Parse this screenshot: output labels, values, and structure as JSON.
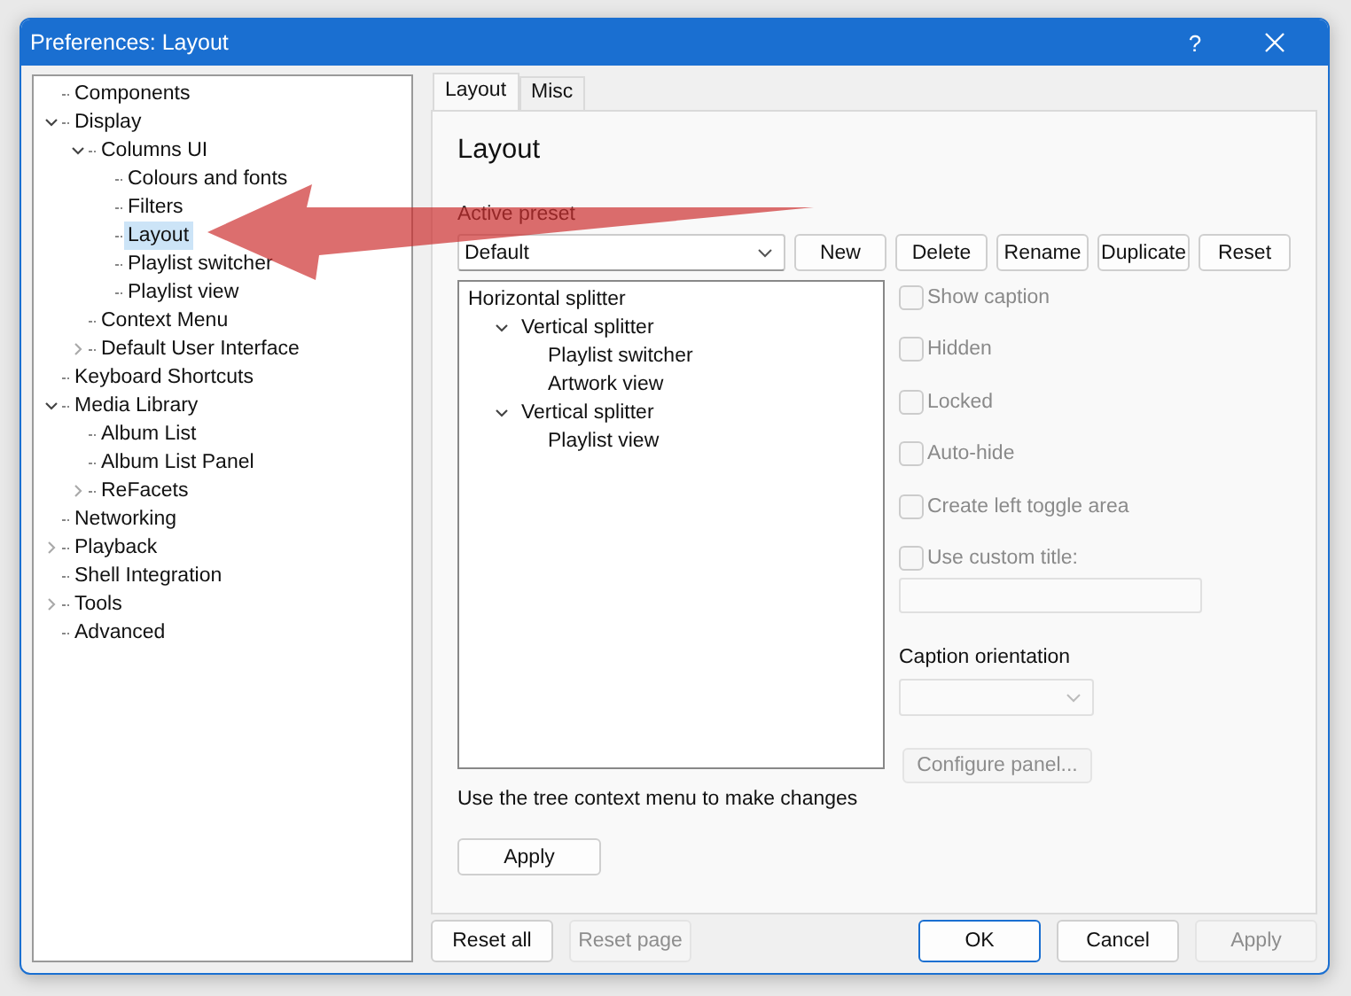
{
  "window": {
    "title": "Preferences: Layout",
    "help": "?"
  },
  "tree": [
    {
      "label": "Components",
      "selected": false
    },
    {
      "label": "Display",
      "selected": false,
      "expanded": true,
      "children": [
        {
          "label": "Columns UI",
          "selected": false,
          "expanded": true,
          "children": [
            {
              "label": "Colours and fonts",
              "selected": false
            },
            {
              "label": "Filters",
              "selected": false
            },
            {
              "label": "Layout",
              "selected": true
            },
            {
              "label": "Playlist switcher",
              "selected": false
            },
            {
              "label": "Playlist view",
              "selected": false
            }
          ]
        },
        {
          "label": "Context Menu",
          "selected": false
        },
        {
          "label": "Default User Interface",
          "selected": false,
          "expanded": false
        }
      ]
    },
    {
      "label": "Keyboard Shortcuts",
      "selected": false
    },
    {
      "label": "Media Library",
      "selected": false,
      "expanded": true,
      "children": [
        {
          "label": "Album List",
          "selected": false
        },
        {
          "label": "Album List Panel",
          "selected": false
        },
        {
          "label": "ReFacets",
          "selected": false,
          "expanded": false
        }
      ]
    },
    {
      "label": "Networking",
      "selected": false
    },
    {
      "label": "Playback",
      "selected": false,
      "expanded": false
    },
    {
      "label": "Shell Integration",
      "selected": false
    },
    {
      "label": "Tools",
      "selected": false,
      "expanded": false
    },
    {
      "label": "Advanced",
      "selected": false
    }
  ],
  "tabs": [
    {
      "label": "Layout",
      "selected": true
    },
    {
      "label": "Misc",
      "selected": false
    }
  ],
  "page": {
    "heading": "Layout",
    "preset_label": "Active preset",
    "preset_value": "Default",
    "preset_buttons": [
      "New",
      "Delete",
      "Rename",
      "Duplicate",
      "Reset"
    ],
    "layout_tree": [
      {
        "label": "Horizontal splitter",
        "children": [
          {
            "label": "Vertical splitter",
            "expanded": true,
            "children": [
              {
                "label": "Playlist switcher"
              },
              {
                "label": "Artwork view"
              }
            ]
          },
          {
            "label": "Vertical splitter",
            "expanded": true,
            "children": [
              {
                "label": "Playlist view"
              }
            ]
          }
        ]
      }
    ],
    "options": [
      {
        "label": "Show caption",
        "checked": false,
        "disabled": true
      },
      {
        "label": "Hidden",
        "checked": false,
        "disabled": true
      },
      {
        "label": "Locked",
        "checked": false,
        "disabled": true
      },
      {
        "label": "Auto-hide",
        "checked": false,
        "disabled": true
      },
      {
        "label": "Create left toggle area",
        "checked": false,
        "disabled": true
      },
      {
        "label": "Use custom title:",
        "checked": false,
        "disabled": true
      }
    ],
    "caption_label": "Caption orientation",
    "configure_button": {
      "label": "Configure panel...",
      "disabled": true
    },
    "hint": "Use the tree context menu to make changes",
    "apply_button": "Apply"
  },
  "footer_left": [
    {
      "label": "Reset all",
      "disabled": false,
      "default": false
    },
    {
      "label": "Reset page",
      "disabled": true,
      "default": false
    }
  ],
  "footer_right": [
    {
      "label": "OK",
      "disabled": false,
      "default": true
    },
    {
      "label": "Cancel",
      "disabled": false,
      "default": false
    },
    {
      "label": "Apply",
      "disabled": true,
      "default": false
    }
  ]
}
